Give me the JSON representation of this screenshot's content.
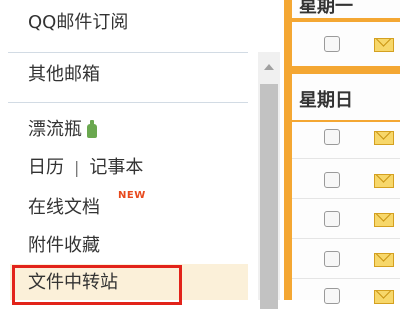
{
  "sidebar": {
    "qq_subscribe": "QQ邮件订阅",
    "other_mailbox": "其他邮箱",
    "drift_bottle": "漂流瓶",
    "calendar": "日历",
    "separator": "|",
    "notebook": "记事本",
    "online_docs": "在线文档",
    "new_badge": "NEW",
    "attachments": "附件收藏",
    "file_transfer": "文件中转站"
  },
  "main": {
    "group_monday": "星期一",
    "group_sunday": "星期日"
  },
  "colors": {
    "accent_orange": "#f4a733",
    "highlight_bg": "#fbf0d9",
    "annotation_red": "#e2231a",
    "new_badge": "#e8491d"
  }
}
